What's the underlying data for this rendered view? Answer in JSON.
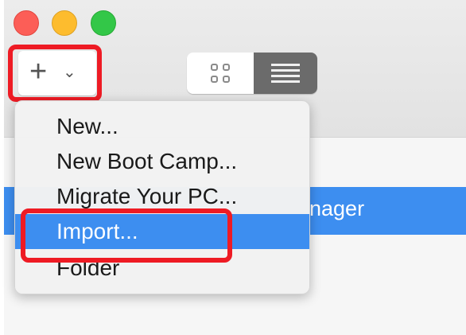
{
  "toolbar": {
    "add_label": "+",
    "add_chevron": "⌄",
    "view_modes": [
      {
        "name": "grid",
        "icon": "grid-view-icon",
        "selected": false
      },
      {
        "name": "list",
        "icon": "list-view-icon",
        "selected": true
      }
    ]
  },
  "menu": {
    "items": [
      {
        "label": "New..."
      },
      {
        "label": "New Boot Camp..."
      },
      {
        "label": "Migrate Your PC..."
      },
      {
        "label": "Import...",
        "highlighted": true
      },
      {
        "label": "Folder"
      }
    ]
  },
  "list": {
    "selected_row_visible_text": "nager"
  },
  "colors": {
    "accent": "#3d8ef0",
    "highlight_annotation": "#ee1b24",
    "close": "#fc5e57",
    "minimize": "#fdbc2e",
    "maximize": "#33c748"
  }
}
